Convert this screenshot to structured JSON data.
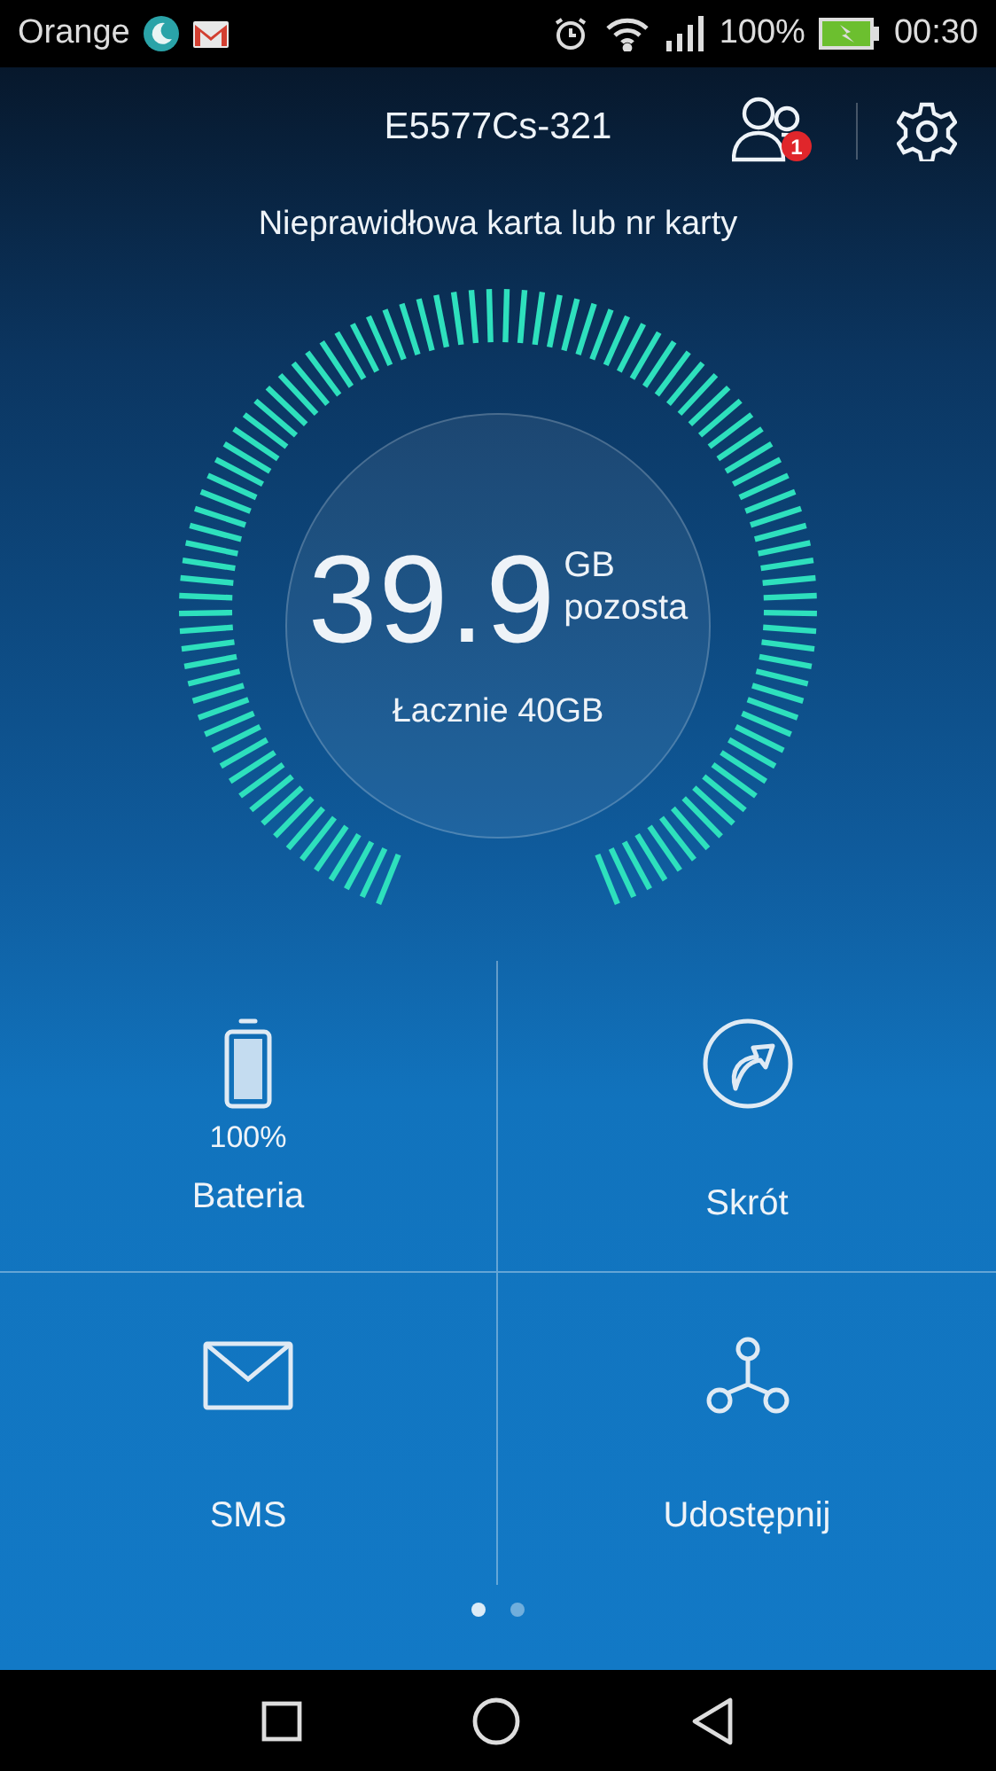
{
  "status_bar": {
    "carrier": "Orange",
    "battery": "100%",
    "time": "00:30"
  },
  "header": {
    "title": "E5577Cs-321",
    "users_badge": "1"
  },
  "message": "Nieprawidłowa karta lub nr karty",
  "gauge": {
    "value": "39.9",
    "unit": "GB",
    "caption": "pozosta",
    "total": "Łacznie 40GB"
  },
  "tiles": [
    {
      "kind": "battery",
      "reading": "100%",
      "label": "Bateria"
    },
    {
      "kind": "shortcut",
      "label": "Skrót"
    },
    {
      "kind": "sms",
      "label": "SMS"
    },
    {
      "kind": "share",
      "label": "Udostępnij"
    }
  ],
  "pages": [
    {
      "selected": true
    },
    {
      "selected": false
    }
  ]
}
